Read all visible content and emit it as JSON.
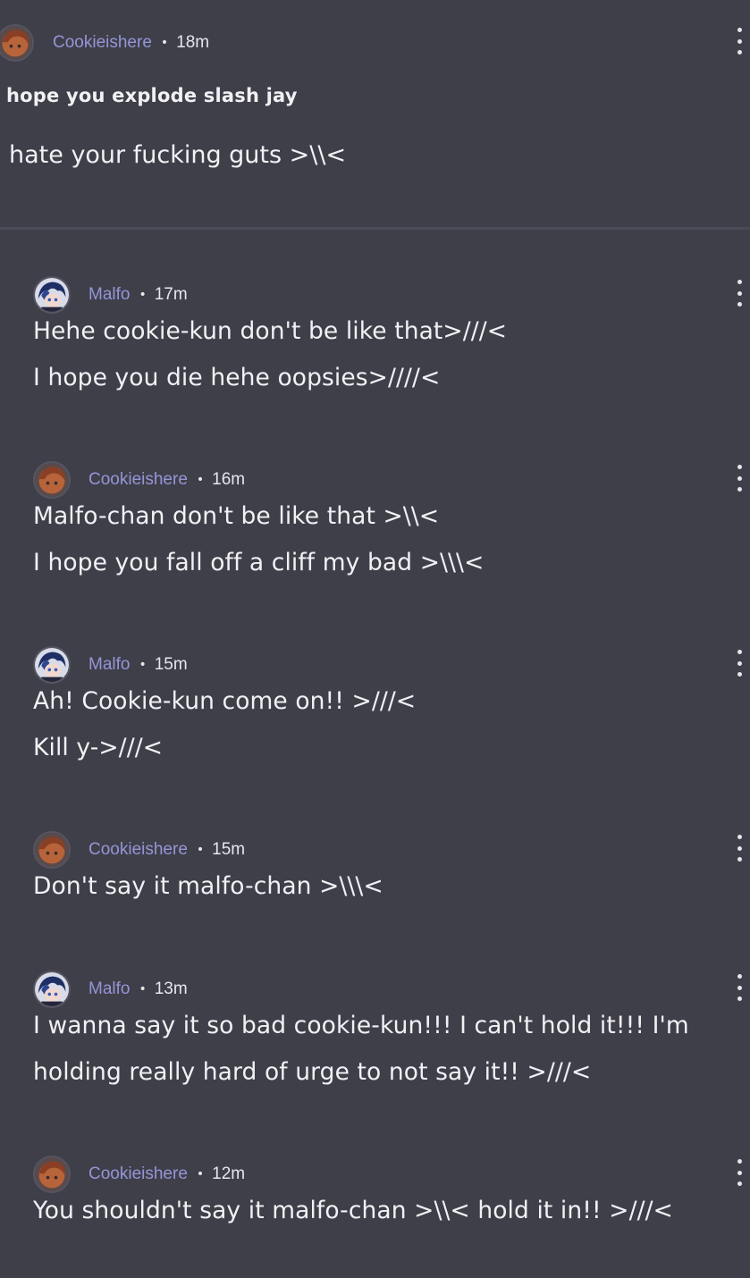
{
  "post": {
    "author": "Cookieishere",
    "time": "18m",
    "title": "hope you explode slash jay",
    "body": "hate your fucking guts >\\\\<",
    "avatar": "cookieishere-avatar"
  },
  "comments": [
    {
      "author": "Malfo",
      "time": "17m",
      "avatar": "malfo-avatar",
      "lines": [
        "Hehe cookie-kun don't be like that>///<",
        "I hope you die hehe oopsies>////<"
      ]
    },
    {
      "author": "Cookieishere",
      "time": "16m",
      "avatar": "cookieishere-avatar",
      "lines": [
        "Malfo-chan don't be like that >\\\\<",
        "I hope you fall off a cliff my bad >\\\\\\<"
      ]
    },
    {
      "author": "Malfo",
      "time": "15m",
      "avatar": "malfo-avatar",
      "lines": [
        "Ah! Cookie-kun come on!! >///<",
        "Kill y->///<"
      ]
    },
    {
      "author": "Cookieishere",
      "time": "15m",
      "avatar": "cookieishere-avatar",
      "lines": [
        "Don't say it malfo-chan >\\\\\\<"
      ]
    },
    {
      "author": "Malfo",
      "time": "13m",
      "avatar": "malfo-avatar",
      "lines": [
        "I wanna say it so bad cookie-kun!!! I can't hold it!!! I'm",
        "holding really hard of urge to not say it!! >///<"
      ]
    },
    {
      "author": "Cookieishere",
      "time": "12m",
      "avatar": "cookieishere-avatar",
      "lines": [
        "You shouldn't say it malfo-chan >\\\\< hold it in!! >///<"
      ]
    }
  ],
  "separator": "•",
  "colors": {
    "background": "#3f3f4a",
    "username": "#9595d6",
    "text": "#f1f1f4",
    "divider": "#4b4b57"
  },
  "icons": {
    "more": "kebab-menu-icon"
  }
}
